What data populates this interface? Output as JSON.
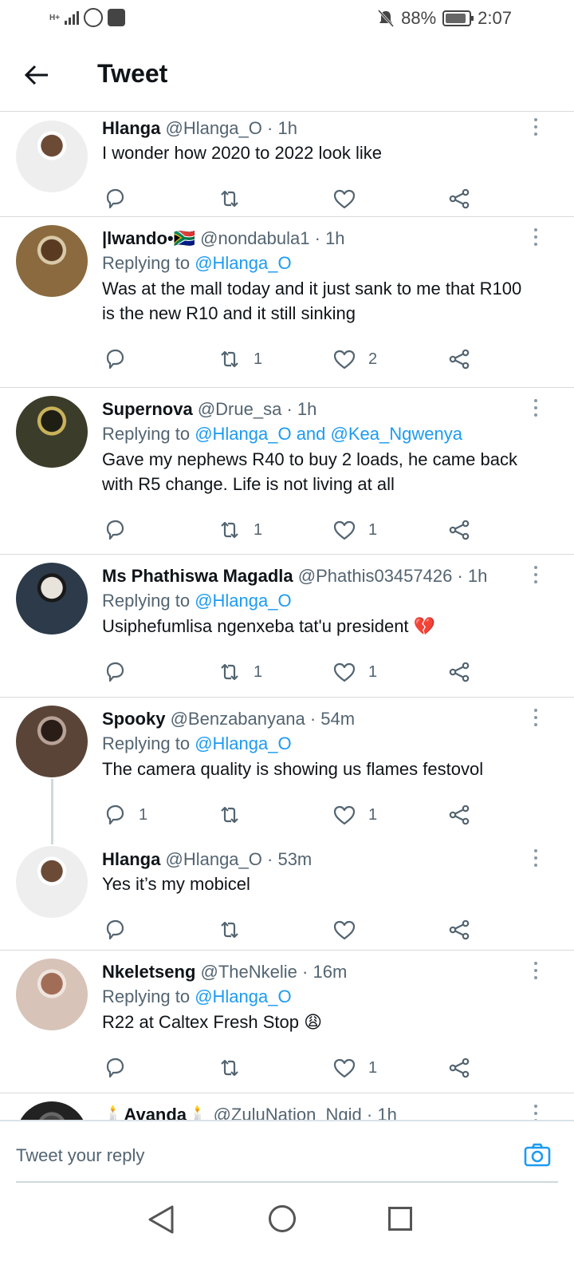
{
  "status_bar": {
    "network": "H+",
    "battery_percent": "88%",
    "battery_level": 0.88,
    "time": "2:07"
  },
  "header": {
    "title": "Tweet"
  },
  "tweets": [
    {
      "name": "Hlanga",
      "handle": "@Hlanga_O",
      "time": "1h",
      "replying": null,
      "text": "I wonder how 2020 to 2022 look like",
      "replies": "",
      "retweets": "",
      "likes": "",
      "avatar_colors": [
        "#efeeee",
        "#6b4a36",
        "#ffffff"
      ]
    },
    {
      "name": "|lwando•🇿🇦",
      "handle": "@nondabula1",
      "time": "1h",
      "replying_prefix": "Replying to ",
      "replying": "@Hlanga_O",
      "text": "Was at the mall today and it just sank to me that R100 is the new R10 and it still sinking",
      "replies": "",
      "retweets": "1",
      "likes": "2",
      "avatar_colors": [
        "#8a6a3e",
        "#5a3b22",
        "#d9c9a8"
      ]
    },
    {
      "name": "Supernova",
      "handle": "@Drue_sa",
      "time": "1h",
      "replying_prefix": "Replying to ",
      "replying": "@Hlanga_O and @Kea_Ngwenya",
      "text": "Gave my nephews R40 to buy 2 loads, he came back with R5 change. Life is not living at all",
      "replies": "",
      "retweets": "1",
      "likes": "1",
      "avatar_colors": [
        "#3b3d2a",
        "#1e1e15",
        "#c9b25a"
      ]
    },
    {
      "name": "Ms Phathiswa Magadla",
      "handle": "@Phathis03457426",
      "time": "1h",
      "replying_prefix": "Replying to ",
      "replying": "@Hlanga_O",
      "text": "Usiphefumlisa ngenxeba tat'u president 💔",
      "replies": "",
      "retweets": "1",
      "likes": "1",
      "avatar_colors": [
        "#2c3a4a",
        "#e8e4dc",
        "#191919"
      ]
    },
    {
      "name": "Spooky",
      "handle": "@Benzabanyana",
      "time": "54m",
      "replying_prefix": "Replying to ",
      "replying": "@Hlanga_O",
      "text": "The camera quality is showing us flames festovol",
      "replies": "1",
      "retweets": "",
      "likes": "1",
      "avatar_colors": [
        "#5a4438",
        "#2a1d17",
        "#b8a297"
      ]
    },
    {
      "name": "Hlanga",
      "handle": "@Hlanga_O",
      "time": "53m",
      "replying": null,
      "text": "Yes it’s my mobicel",
      "replies": "",
      "retweets": "",
      "likes": "",
      "avatar_colors": [
        "#efeeee",
        "#6b4a36",
        "#ffffff"
      ]
    },
    {
      "name": "Nkeletseng",
      "handle": "@TheNkelie",
      "time": "16m",
      "replying_prefix": "Replying to ",
      "replying": "@Hlanga_O",
      "text": "R22 at Caltex Fresh Stop 😩",
      "replies": "",
      "retweets": "",
      "likes": "1",
      "avatar_colors": [
        "#d7c3b8",
        "#a26d57",
        "#efe5df"
      ]
    },
    {
      "name": "🕯️Avanda🕯️",
      "handle": "@ZuluNation_Ngid",
      "time": "1h",
      "replying": null,
      "text": "",
      "replies": "",
      "retweets": "",
      "likes": "",
      "avatar_colors": [
        "#222",
        "#444",
        "#666"
      ]
    }
  ],
  "reply_bar": {
    "placeholder": "Tweet your reply"
  }
}
